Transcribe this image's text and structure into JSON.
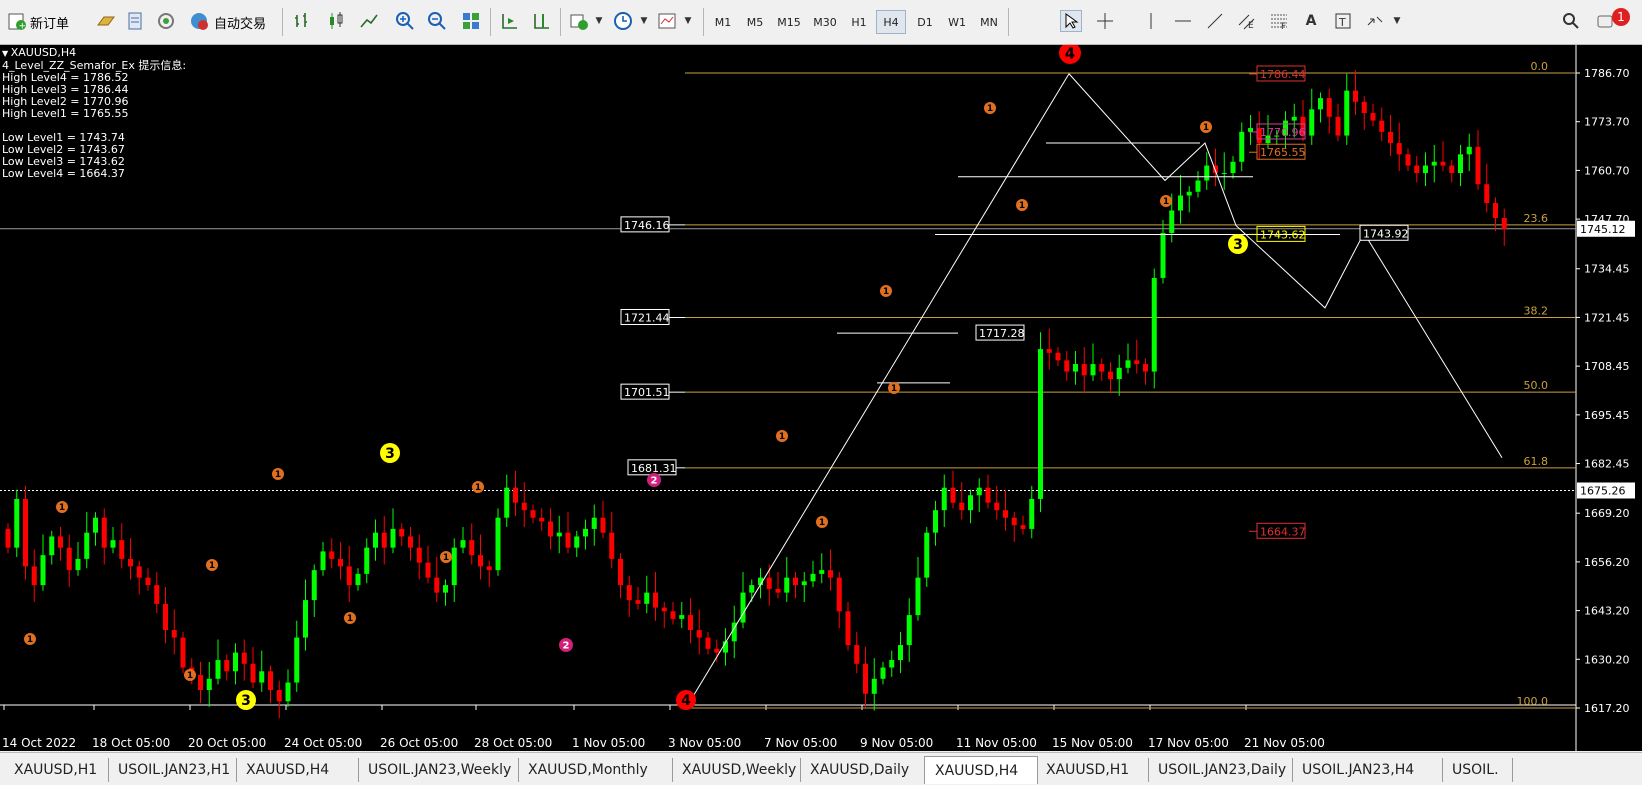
{
  "toolbar": {
    "new_order": "新订单",
    "auto_trading": "自动交易",
    "timeframes": [
      "M1",
      "M5",
      "M15",
      "M30",
      "H1",
      "H4",
      "D1",
      "W1",
      "MN"
    ],
    "active_timeframe": "H4",
    "notification_count": "1"
  },
  "chart": {
    "symbol_label": "XAUUSD,H4",
    "indicator_title": "4_Level_ZZ_Semafor_Ex 提示信息:",
    "high_levels": [
      "High Level4 = 1786.52",
      "High Level3 = 1786.44",
      "High Level2 = 1770.96",
      "High Level1 = 1765.55"
    ],
    "low_levels": [
      "Low Level1 = 1743.74",
      "Low Level2 = 1743.67",
      "Low Level3 = 1743.62",
      "Low Level4 = 1664.37"
    ],
    "price_axis": [
      "1786.70",
      "1773.70",
      "1760.70",
      "1747.70",
      "1734.45",
      "1721.45",
      "1708.45",
      "1695.45",
      "1682.45",
      "1669.20",
      "1656.20",
      "1643.20",
      "1630.20",
      "1617.20"
    ],
    "current_price": "1745.12",
    "dotted_price": "1675.26",
    "time_axis": [
      "14 Oct 2022",
      "18 Oct 05:00",
      "20 Oct 05:00",
      "24 Oct 05:00",
      "26 Oct 05:00",
      "28 Oct 05:00",
      "1 Nov 05:00",
      "3 Nov 05:00",
      "7 Nov 05:00",
      "9 Nov 05:00",
      "11 Nov 05:00",
      "15 Nov 05:00",
      "17 Nov 05:00",
      "21 Nov 05:00"
    ],
    "fib_levels": [
      "0.0",
      "23.6",
      "38.2",
      "50.0",
      "61.8",
      "100.0"
    ],
    "fib_price_labels": [
      "1746.16",
      "1721.44",
      "1701.51",
      "1681.31"
    ],
    "box_labels": [
      "1717.28",
      "1743.92"
    ],
    "level_labels": [
      "1786.44",
      "1770.96",
      "1765.55",
      "1743.62",
      "1664.37"
    ],
    "semafor_numbers": [
      "1",
      "2",
      "3",
      "4"
    ],
    "colors": {
      "bull": "#00ff00",
      "bear": "#ff0000",
      "fib": "#c8a040",
      "semafor1": "#e07020",
      "semafor2": "#d0207a",
      "semafor3": "#ffff00",
      "semafor4": "#ff0000"
    }
  },
  "tabs": [
    "XAUUSD,H1",
    "USOIL.JAN23,H1",
    "XAUUSD,H4",
    "USOIL.JAN23,Weekly",
    "XAUUSD,Monthly",
    "XAUUSD,Weekly",
    "XAUUSD,Daily",
    "XAUUSD,H4",
    "XAUUSD,H1",
    "USOIL.JAN23,Daily",
    "USOIL.JAN23,H4",
    "USOIL."
  ],
  "active_tab_index": 7
}
